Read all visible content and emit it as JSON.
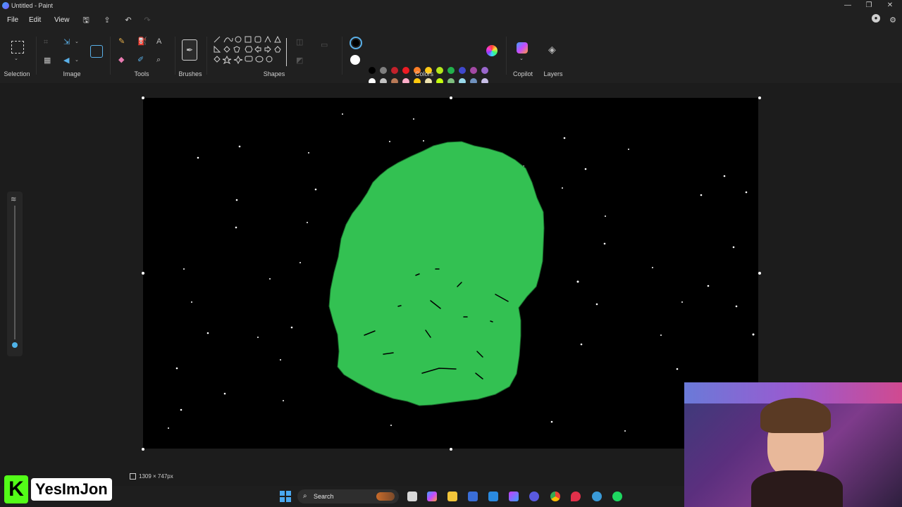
{
  "window": {
    "title": "Untitled - Paint",
    "minimize_glyph": "—",
    "restore_glyph": "❐",
    "close_glyph": "✕"
  },
  "menu": {
    "file": "File",
    "edit": "Edit",
    "view": "View"
  },
  "ribbon": {
    "groups": {
      "selection": "Selection",
      "image": "Image",
      "tools": "Tools",
      "brushes": "Brushes",
      "shapes": "Shapes",
      "colors": "Colors",
      "copilot": "Copilot",
      "layers": "Layers"
    },
    "colors": {
      "current_primary": "#000000",
      "current_secondary": "#ffffff",
      "palette_row1": [
        "#000000",
        "#7f7f7f",
        "#c3212b",
        "#ec1c24",
        "#ff7f27",
        "#ffca18",
        "#b5e61d",
        "#22b14c",
        "#3f48cc",
        "#a349a4",
        "#9966cc"
      ],
      "palette_row2": [
        "#ffffff",
        "#c3c3c3",
        "#b97a57",
        "#ffaec9",
        "#ffc90e",
        "#efe4b0",
        "#c4ff0e",
        "#7fbf7f",
        "#99d9ea",
        "#7092be",
        "#c8bfe7"
      ]
    }
  },
  "canvas": {
    "background": "#000000",
    "blob_color": "#33c152"
  },
  "statusbar": {
    "dimensions": "1309 × 747px"
  },
  "taskbar": {
    "search_label": "Search"
  },
  "overlay": {
    "streamer_name": "YesImJon"
  }
}
